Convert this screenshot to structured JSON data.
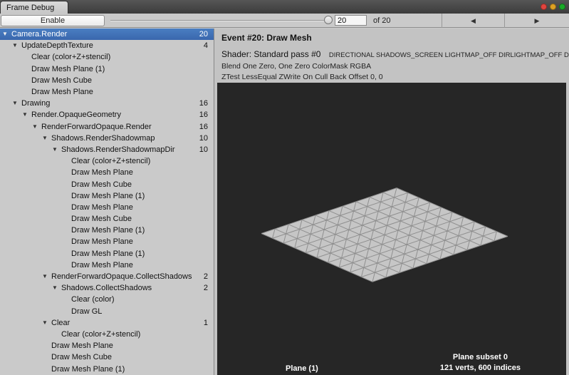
{
  "window": {
    "tab_title": "Frame Debug"
  },
  "toolbar": {
    "enable_label": "Enable",
    "event_value": "20",
    "of_label": "of 20",
    "prev_icon": "◀",
    "next_icon": "▶"
  },
  "tree": {
    "rows": [
      {
        "label": "Camera.Render",
        "count": "20",
        "level": 0,
        "expanded": true,
        "selected": true
      },
      {
        "label": "UpdateDepthTexture",
        "count": "4",
        "level": 1,
        "expanded": true,
        "selected": false
      },
      {
        "label": "Clear (color+Z+stencil)",
        "count": "",
        "level": 2,
        "expanded": false,
        "selected": false
      },
      {
        "label": "Draw Mesh Plane (1)",
        "count": "",
        "level": 2,
        "expanded": false,
        "selected": false
      },
      {
        "label": "Draw Mesh Cube",
        "count": "",
        "level": 2,
        "expanded": false,
        "selected": false
      },
      {
        "label": "Draw Mesh Plane",
        "count": "",
        "level": 2,
        "expanded": false,
        "selected": false
      },
      {
        "label": "Drawing",
        "count": "16",
        "level": 1,
        "expanded": true,
        "selected": false
      },
      {
        "label": "Render.OpaqueGeometry",
        "count": "16",
        "level": 2,
        "expanded": true,
        "selected": false
      },
      {
        "label": "RenderForwardOpaque.Render",
        "count": "16",
        "level": 3,
        "expanded": true,
        "selected": false
      },
      {
        "label": "Shadows.RenderShadowmap",
        "count": "10",
        "level": 4,
        "expanded": true,
        "selected": false
      },
      {
        "label": "Shadows.RenderShadowmapDir",
        "count": "10",
        "level": 5,
        "expanded": true,
        "selected": false
      },
      {
        "label": "Clear (color+Z+stencil)",
        "count": "",
        "level": 6,
        "expanded": false,
        "selected": false
      },
      {
        "label": "Draw Mesh Plane",
        "count": "",
        "level": 6,
        "expanded": false,
        "selected": false
      },
      {
        "label": "Draw Mesh Cube",
        "count": "",
        "level": 6,
        "expanded": false,
        "selected": false
      },
      {
        "label": "Draw Mesh Plane (1)",
        "count": "",
        "level": 6,
        "expanded": false,
        "selected": false
      },
      {
        "label": "Draw Mesh Plane",
        "count": "",
        "level": 6,
        "expanded": false,
        "selected": false
      },
      {
        "label": "Draw Mesh Cube",
        "count": "",
        "level": 6,
        "expanded": false,
        "selected": false
      },
      {
        "label": "Draw Mesh Plane (1)",
        "count": "",
        "level": 6,
        "expanded": false,
        "selected": false
      },
      {
        "label": "Draw Mesh Plane",
        "count": "",
        "level": 6,
        "expanded": false,
        "selected": false
      },
      {
        "label": "Draw Mesh Plane (1)",
        "count": "",
        "level": 6,
        "expanded": false,
        "selected": false
      },
      {
        "label": "Draw Mesh Plane",
        "count": "",
        "level": 6,
        "expanded": false,
        "selected": false
      },
      {
        "label": "RenderForwardOpaque.CollectShadows",
        "count": "2",
        "level": 4,
        "expanded": true,
        "selected": false
      },
      {
        "label": "Shadows.CollectShadows",
        "count": "2",
        "level": 5,
        "expanded": true,
        "selected": false
      },
      {
        "label": "Clear (color)",
        "count": "",
        "level": 6,
        "expanded": false,
        "selected": false
      },
      {
        "label": "Draw GL",
        "count": "",
        "level": 6,
        "expanded": false,
        "selected": false
      },
      {
        "label": "Clear",
        "count": "1",
        "level": 4,
        "expanded": true,
        "selected": false
      },
      {
        "label": "Clear (color+Z+stencil)",
        "count": "",
        "level": 5,
        "expanded": false,
        "selected": false
      },
      {
        "label": "Draw Mesh Plane",
        "count": "",
        "level": 4,
        "expanded": false,
        "selected": false
      },
      {
        "label": "Draw Mesh Cube",
        "count": "",
        "level": 4,
        "expanded": false,
        "selected": false
      },
      {
        "label": "Draw Mesh Plane (1)",
        "count": "",
        "level": 4,
        "expanded": false,
        "selected": false
      }
    ]
  },
  "detail": {
    "title": "Event #20: Draw Mesh",
    "shader_label": "Shader: Standard pass #0",
    "shader_keywords": "DIRECTIONAL SHADOWS_SCREEN LIGHTMAP_OFF DIRLIGHTMAP_OFF DYNAMICLIGHTMAP_OFF",
    "blend_line": "Blend One Zero, One Zero ColorMask RGBA",
    "ztest_line": "ZTest LessEqual ZWrite On Cull Back Offset 0, 0",
    "preview": {
      "object_label": "Plane (1)",
      "subset_label": "Plane subset 0",
      "stats_label": "121 verts, 600 indices",
      "grid_divisions": 10
    }
  },
  "colors": {
    "selection": "#3e6db5",
    "preview_bg": "#262626",
    "plane_fill": "#c6c6c6",
    "plane_wire": "#8f8f8f",
    "traffic_red": "#e0443e",
    "traffic_yellow": "#dea123",
    "traffic_green": "#1aab29"
  }
}
